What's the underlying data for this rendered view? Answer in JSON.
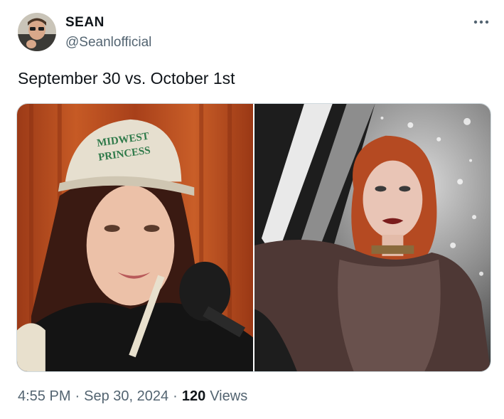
{
  "author": {
    "display_name": "SEAN",
    "handle": "@Seanlofficial"
  },
  "tweet": {
    "text": "September 30 vs. October 1st"
  },
  "media": {
    "left_image": {
      "cap_text_line1": "MIDWEST",
      "cap_text_line2": "PRINCESS"
    }
  },
  "meta": {
    "time": "4:55 PM",
    "separator": "·",
    "date": "Sep 30, 2024",
    "views_count": "120",
    "views_label": "Views"
  },
  "icons": {
    "more": "more-horizontal-icon",
    "avatar": "profile-photo"
  },
  "colors": {
    "text_primary": "#0f1419",
    "text_secondary": "#536471",
    "border": "#cfd9de"
  }
}
